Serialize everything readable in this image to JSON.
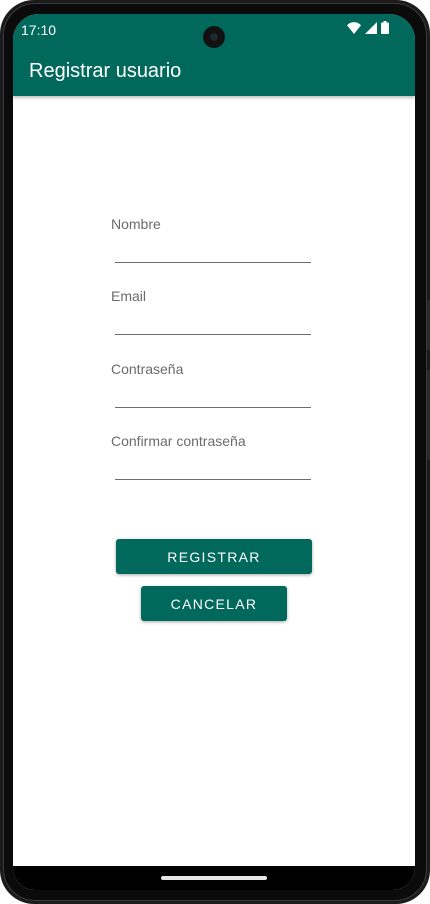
{
  "status_bar": {
    "time": "17:10",
    "icons": [
      "wifi-icon",
      "cellular-signal-icon",
      "battery-icon"
    ]
  },
  "app_bar": {
    "title": "Registrar usuario"
  },
  "form": {
    "fields": [
      {
        "label": "Nombre",
        "value": ""
      },
      {
        "label": "Email",
        "value": ""
      },
      {
        "label": "Contraseña",
        "value": ""
      },
      {
        "label": "Confirmar contraseña",
        "value": ""
      }
    ],
    "register_label": "REGISTRAR",
    "cancel_label": "CANCELAR"
  },
  "colors": {
    "primary": "#00695c",
    "on_primary": "#ffffff",
    "label": "#6b6b6b",
    "underline": "#6f6f6f"
  }
}
